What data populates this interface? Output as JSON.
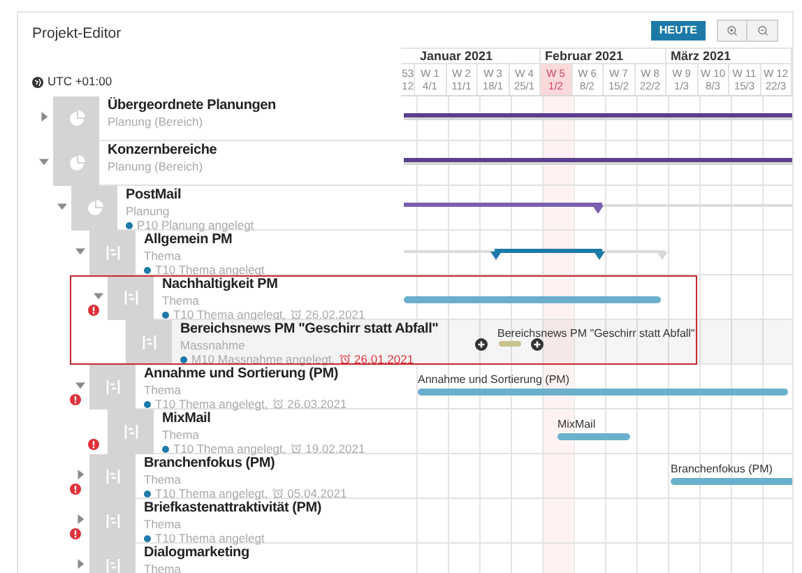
{
  "title": "Projekt-Editor",
  "timezone": "UTC +01:00",
  "toolbar": {
    "today_button": "HEUTE"
  },
  "months": [
    {
      "label": "Januar 2021"
    },
    {
      "label": "Februar 2021"
    },
    {
      "label": "März 2021"
    }
  ],
  "weeks": [
    {
      "week": "53",
      "date": "12",
      "current": false,
      "kind": "partial"
    },
    {
      "week": "W 1",
      "date": "4/1",
      "current": false,
      "kind": "full"
    },
    {
      "week": "W 2",
      "date": "11/1",
      "current": false,
      "kind": "full"
    },
    {
      "week": "W 3",
      "date": "18/1",
      "current": false,
      "kind": "full"
    },
    {
      "week": "W 4",
      "date": "25/1",
      "current": false,
      "kind": "full"
    },
    {
      "week": "W 5",
      "date": "1/2",
      "current": true,
      "kind": "full"
    },
    {
      "week": "W 6",
      "date": "8/2",
      "current": false,
      "kind": "full"
    },
    {
      "week": "W 7",
      "date": "15/2",
      "current": false,
      "kind": "full"
    },
    {
      "week": "W 8",
      "date": "22/2",
      "current": false,
      "kind": "full"
    },
    {
      "week": "W 9",
      "date": "1/3",
      "current": false,
      "kind": "full"
    },
    {
      "week": "W 10",
      "date": "8/3",
      "current": false,
      "kind": "full"
    },
    {
      "week": "W 11",
      "date": "15/3",
      "current": false,
      "kind": "full"
    },
    {
      "week": "W 12",
      "date": "22/3",
      "current": false,
      "kind": "full"
    }
  ],
  "tree": [
    {
      "title": "Übergeordnete Planungen",
      "type": "Planung (Bereich)",
      "kind": "planning",
      "expanded": false,
      "warning": false,
      "selected": false,
      "bar": {
        "kind": "planning"
      }
    },
    {
      "title": "Konzernbereiche",
      "type": "Planung (Bereich)",
      "kind": "planning",
      "expanded": true,
      "warning": false,
      "selected": false,
      "bar": {
        "kind": "planning"
      },
      "children": [
        {
          "title": "PostMail",
          "type": "Planung",
          "kind": "planning",
          "status": "P10 Planung angelegt",
          "expanded": true,
          "warning": false,
          "selected": false,
          "bar": {
            "kind": "planning-milestone"
          },
          "children": [
            {
              "title": "Allgemein PM",
              "type": "Thema",
              "kind": "topic",
              "status": "T10 Thema angelegt",
              "expanded": true,
              "warning": false,
              "selected": false,
              "bar": {
                "kind": "range"
              },
              "children": [
                {
                  "title": "Nachhaltigkeit PM",
                  "type": "Thema",
                  "kind": "topic",
                  "status": "T10 Thema angelegt,",
                  "due": "26.02.2021",
                  "overdue": false,
                  "expanded": true,
                  "warning": true,
                  "selected": true,
                  "bar": {
                    "kind": "topic"
                  },
                  "children": [
                    {
                      "title": "Bereichsnews PM \"Geschirr statt Abfall\"",
                      "type": "Massnahme",
                      "kind": "measure",
                      "status": "M10 Massnahme angelegt,",
                      "due": "26.01.2021",
                      "overdue": true,
                      "warning": false,
                      "selected": false,
                      "bar": {
                        "kind": "measure",
                        "label": "Bereichsnews PM \"Geschirr statt Abfall\""
                      }
                    }
                  ]
                }
              ]
            },
            {
              "title": "Annahme und Sortierung (PM)",
              "type": "Thema",
              "kind": "topic",
              "status": "T10 Thema angelegt,",
              "due": "26.03.2021",
              "overdue": false,
              "expanded": true,
              "warning": true,
              "selected": false,
              "bar": {
                "kind": "topic",
                "label": "Annahme und Sortierung (PM)"
              },
              "children": [
                {
                  "title": "MixMail",
                  "type": "Thema",
                  "kind": "topic",
                  "status": "T10 Thema angelegt,",
                  "due": "19.02.2021",
                  "overdue": false,
                  "warning": true,
                  "selected": false,
                  "bar": {
                    "kind": "topic",
                    "label": "MixMail"
                  }
                }
              ]
            },
            {
              "title": "Branchenfokus (PM)",
              "type": "Thema",
              "kind": "topic",
              "status": "T10 Thema angelegt,",
              "due": "05.04.2021",
              "overdue": false,
              "expanded": false,
              "warning": true,
              "selected": false,
              "bar": {
                "kind": "topic",
                "label": "Branchenfokus (PM)"
              }
            },
            {
              "title": "Briefkastenattraktivität (PM)",
              "type": "Thema",
              "kind": "topic",
              "status": "T10 Thema angelegt",
              "expanded": false,
              "warning": true,
              "selected": false
            },
            {
              "title": "Dialogmarketing",
              "type": "Thema",
              "kind": "topic",
              "expanded": false,
              "warning": false,
              "selected": false
            }
          ]
        }
      ]
    }
  ]
}
